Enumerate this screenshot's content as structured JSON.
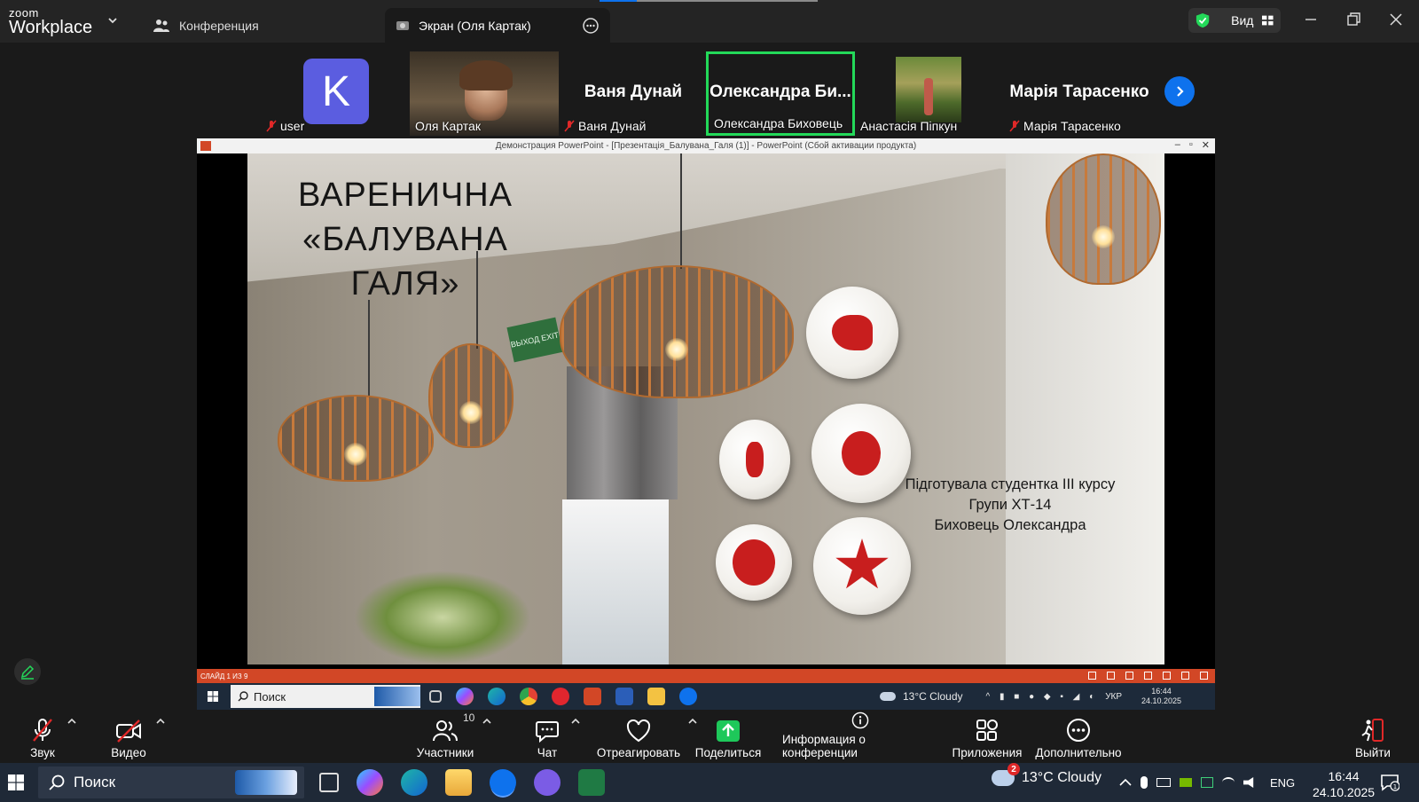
{
  "app": {
    "brand_top": "zoom",
    "brand_bottom": "Workplace",
    "tabs": [
      {
        "label": "Конференция"
      },
      {
        "label": "Экран (Оля Картак)"
      }
    ],
    "view_label": "Вид"
  },
  "participants": [
    {
      "name": "user",
      "avatar_letter": "K",
      "muted": true
    },
    {
      "name": "Оля Картак",
      "muted": false
    },
    {
      "name": "Ваня Дунай",
      "big_name": "Ваня Дунай",
      "muted": true
    },
    {
      "name": "Олександра Биховець",
      "big_name": "Олександра Би...",
      "muted": false,
      "speaking": true
    },
    {
      "name": "Анастасія Піпкун",
      "muted": false
    },
    {
      "name": "Марія Тарасенко",
      "big_name": "Марія Тарасенко",
      "muted": true
    }
  ],
  "shared_screen": {
    "window_title": "Демонстрация PowerPoint - [Презентація_Балувана_Галя (1)] - PowerPoint (Сбой активации продукта)",
    "slide": {
      "title_line1": "ВАРЕНИЧНА",
      "title_line2": "«БАЛУВАНА ГАЛЯ»",
      "exit_sign": "ВЫХОД EXIT",
      "subtitle_line1": "Підготувала студентка ІІІ курсу",
      "subtitle_line2": "Групи ХТ-14",
      "subtitle_line3": "Биховець Олександра"
    },
    "status_bar": "СЛАЙД 1 ИЗ 9",
    "remote_taskbar": {
      "search": "Поиск",
      "weather": "13°C Cloudy",
      "lang": "УКР",
      "time": "16:44",
      "date": "24.10.2025"
    }
  },
  "toolbar": {
    "audio": "Звук",
    "video": "Видео",
    "participants": "Участники",
    "participants_count": "10",
    "chat": "Чат",
    "react": "Отреагировать",
    "share": "Поделиться",
    "info": "Информация о конференции",
    "apps": "Приложения",
    "more": "Дополнительно",
    "leave": "Выйти"
  },
  "windows_taskbar": {
    "search": "Поиск",
    "weather_badge": "2",
    "weather": "13°C Cloudy",
    "lang": "ENG",
    "time": "16:44",
    "date": "24.10.2025"
  },
  "colors": {
    "zoom_blue": "#0e72ed",
    "speaking_green": "#23d959",
    "share_green": "#1ec85a",
    "mute_red": "#e02828",
    "ppt_orange": "#d24726"
  },
  "icons": [
    "zoom-logo",
    "chevron-down-icon",
    "participants-icon",
    "share-screen-icon",
    "more-icon",
    "shield-check-icon",
    "grid-view-icon",
    "minimize-icon",
    "restore-icon",
    "close-icon",
    "mic-muted-icon",
    "video-muted-icon",
    "chat-icon",
    "heart-icon",
    "share-up-arrow-icon",
    "info-icon",
    "apps-icon",
    "ellipsis-icon",
    "leave-icon",
    "pen-icon",
    "windows-start-icon",
    "search-icon"
  ]
}
